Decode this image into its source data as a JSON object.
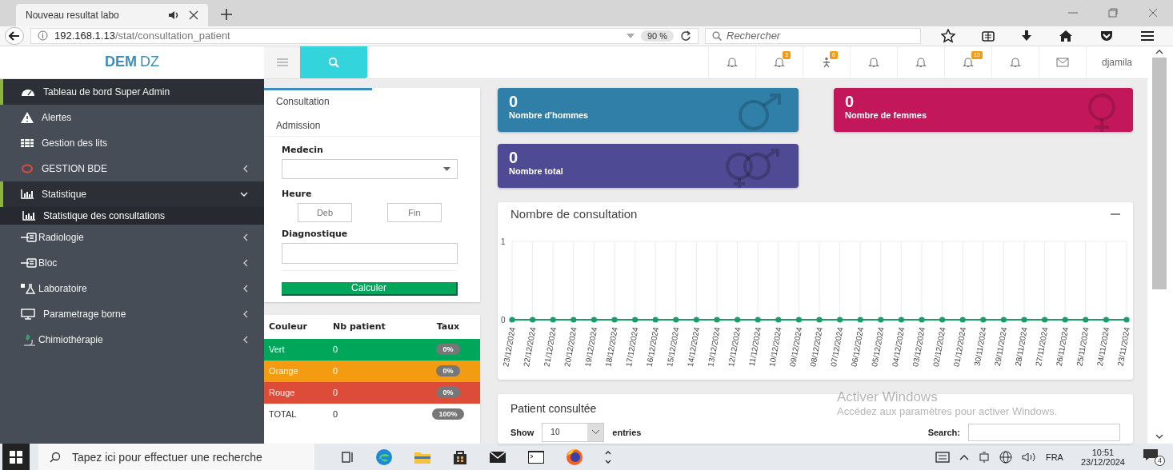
{
  "browser": {
    "tab_title": "Nouveau resultat labo",
    "url_host": "192.168.1.13",
    "url_path": "/stat/consultation_patient",
    "zoom": "90 %",
    "search_placeholder": "Rechercher"
  },
  "header": {
    "logo_bold": "DEM",
    "logo_rest": "DZ",
    "user": "djamila",
    "notifications": [
      {
        "kind": "bell"
      },
      {
        "kind": "bell",
        "badge": "3"
      },
      {
        "kind": "person",
        "badge": "6"
      },
      {
        "kind": "bell"
      },
      {
        "kind": "bell"
      },
      {
        "kind": "bell",
        "badge": "10"
      },
      {
        "kind": "bell"
      },
      {
        "kind": "mail"
      }
    ]
  },
  "sidebar": {
    "items": [
      {
        "label": "Tableau de bord Super Admin",
        "kind": "link",
        "selected": true
      },
      {
        "label": "Alertes",
        "kind": "link",
        "selected": false
      },
      {
        "label": "Gestion des lits",
        "kind": "link",
        "selected": false
      },
      {
        "label": "GESTION BDE",
        "kind": "menu",
        "selected": false,
        "expanded": false
      },
      {
        "label": "Statistique",
        "kind": "menu",
        "selected": true,
        "expanded": true,
        "children": [
          {
            "label": "Statistique des consultations",
            "selected": true
          }
        ]
      },
      {
        "label": "Radiologie",
        "kind": "menu",
        "selected": false,
        "expanded": false
      },
      {
        "label": "Bloc",
        "kind": "menu",
        "selected": false,
        "expanded": false
      },
      {
        "label": "Laboratoire",
        "kind": "menu",
        "selected": false,
        "expanded": false
      },
      {
        "label": "Parametrage borne",
        "kind": "menu",
        "selected": false,
        "expanded": false
      },
      {
        "label": "Chimiothérapie",
        "kind": "menu",
        "selected": false,
        "expanded": false
      }
    ]
  },
  "form_panel": {
    "tabs": [
      {
        "label": "Consultation",
        "selected": true
      },
      {
        "label": "Admission",
        "selected": false
      }
    ],
    "medecin": {
      "label": "Medecin"
    },
    "heure": {
      "label": "Heure",
      "start_placeholder": "Deb",
      "end_placeholder": "Fin"
    },
    "diagnostique": {
      "label": "Diagnostique"
    },
    "button": "Calculer"
  },
  "color_table": {
    "columns": [
      "Couleur",
      "Nb patient",
      "Taux"
    ],
    "rows": [
      {
        "name": "Vert",
        "count": "0",
        "rate": "0%",
        "color": "#00a65a"
      },
      {
        "name": "Orange",
        "count": "0",
        "rate": "0%",
        "color": "#f39c12"
      },
      {
        "name": "Rouge",
        "count": "0",
        "rate": "0%",
        "color": "#dd4b39"
      },
      {
        "name": "TOTAL",
        "count": "0",
        "rate": "100%",
        "color": "#ffffff"
      }
    ]
  },
  "stat_cards": [
    {
      "value": "0",
      "label": "Nombre d'hommes",
      "color": "#2f7fa8"
    },
    {
      "value": "0",
      "label": "Nombre de femmes",
      "color": "#c2185b"
    },
    {
      "value": "0",
      "label": "Nombre total",
      "color": "#4e4a93"
    }
  ],
  "chart_card": {
    "title": "Nombre de consultation",
    "chart_data": {
      "type": "line",
      "categories": [
        "23/12/2024",
        "22/12/2024",
        "21/12/2024",
        "20/12/2024",
        "19/12/2024",
        "18/12/2024",
        "17/12/2024",
        "16/12/2024",
        "15/12/2024",
        "14/12/2024",
        "13/12/2024",
        "12/12/2024",
        "11/12/2024",
        "10/12/2024",
        "09/12/2024",
        "08/12/2024",
        "07/12/2024",
        "06/12/2024",
        "05/12/2024",
        "04/12/2024",
        "03/12/2024",
        "02/12/2024",
        "01/12/2024",
        "30/11/2024",
        "29/11/2024",
        "28/11/2024",
        "27/11/2024",
        "26/11/2024",
        "25/11/2024",
        "24/11/2024",
        "23/11/2024"
      ],
      "series": [
        {
          "color": "#1b9d66",
          "marker": "circle",
          "values": [
            0,
            0,
            0,
            0,
            0,
            0,
            0,
            0,
            0,
            0,
            0,
            0,
            0,
            0,
            0,
            0,
            0,
            0,
            0,
            0,
            0,
            0,
            0,
            0,
            0,
            0,
            0,
            0,
            0,
            0,
            0
          ]
        }
      ],
      "ylim": [
        0,
        1
      ],
      "yticks": [
        0,
        1
      ],
      "grid": true
    }
  },
  "patient_card": {
    "title": "Patient consultée",
    "show_label": "Show",
    "page_size": "10",
    "entries_label": "entries",
    "search_label": "Search:"
  },
  "os_watermark": {
    "title": "Activer Windows",
    "text": "Accédez aux paramètres pour activer Windows."
  },
  "taskbar": {
    "search_placeholder": "Tapez ici pour effectuer une recherche",
    "language": "FRA",
    "time": "10:51",
    "date": "23/12/2024",
    "notification_count": "4"
  }
}
